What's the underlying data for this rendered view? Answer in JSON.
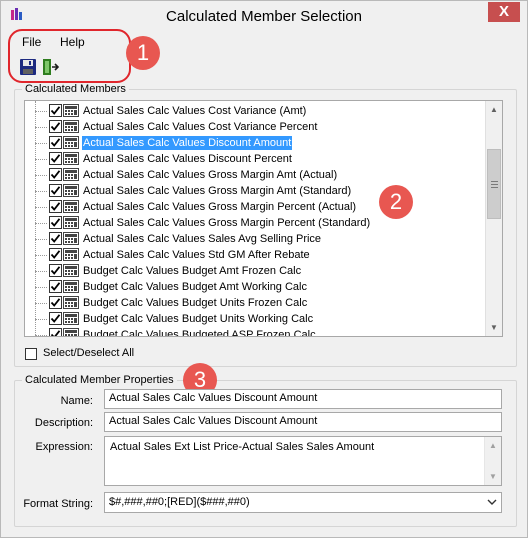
{
  "window": {
    "title": "Calculated Member Selection",
    "close_glyph": "X"
  },
  "menu": {
    "items": [
      "File",
      "Help"
    ]
  },
  "toolbar": {
    "buttons": [
      "save-icon",
      "exit-icon"
    ]
  },
  "callouts": [
    "1",
    "2",
    "3"
  ],
  "calculated_members": {
    "group_label": "Calculated Members",
    "items": [
      {
        "label": "Actual Sales Calc Values Cost Variance (Amt)",
        "checked": true,
        "selected": false
      },
      {
        "label": "Actual Sales Calc Values Cost Variance Percent",
        "checked": true,
        "selected": false
      },
      {
        "label": "Actual Sales Calc Values Discount Amount",
        "checked": true,
        "selected": true
      },
      {
        "label": "Actual Sales Calc Values Discount Percent",
        "checked": true,
        "selected": false
      },
      {
        "label": "Actual Sales Calc Values Gross Margin Amt (Actual)",
        "checked": true,
        "selected": false
      },
      {
        "label": "Actual Sales Calc Values Gross Margin Amt (Standard)",
        "checked": true,
        "selected": false
      },
      {
        "label": "Actual Sales Calc Values Gross Margin Percent (Actual)",
        "checked": true,
        "selected": false
      },
      {
        "label": "Actual Sales Calc Values Gross Margin Percent (Standard)",
        "checked": true,
        "selected": false
      },
      {
        "label": "Actual Sales Calc Values Sales Avg Selling Price",
        "checked": true,
        "selected": false
      },
      {
        "label": "Actual Sales Calc Values Std GM After Rebate",
        "checked": true,
        "selected": false
      },
      {
        "label": "Budget Calc Values Budget Amt Frozen Calc",
        "checked": true,
        "selected": false
      },
      {
        "label": "Budget Calc Values Budget Amt Working Calc",
        "checked": true,
        "selected": false
      },
      {
        "label": "Budget Calc Values Budget Units Frozen Calc",
        "checked": true,
        "selected": false
      },
      {
        "label": "Budget Calc Values Budget Units Working Calc",
        "checked": true,
        "selected": false
      },
      {
        "label": "Budget Calc Values Budgeted ASP Frozen Calc",
        "checked": true,
        "selected": false
      }
    ],
    "select_all_label": "Select/Deselect All"
  },
  "properties": {
    "group_label": "Calculated Member Properties",
    "name_label": "Name:",
    "name_value": "Actual Sales Calc Values Discount Amount",
    "description_label": "Description:",
    "description_value": "Actual Sales Calc Values Discount Amount",
    "expression_label": "Expression:",
    "expression_value": "Actual Sales Ext List Price-Actual Sales Sales Amount",
    "format_label": "Format String:",
    "format_value": "$#,###,##0;[RED]($###,##0)"
  },
  "colors": {
    "accent_selected": "#3399ff",
    "callout_red": "#e85751",
    "close_red": "#c74f4f"
  }
}
